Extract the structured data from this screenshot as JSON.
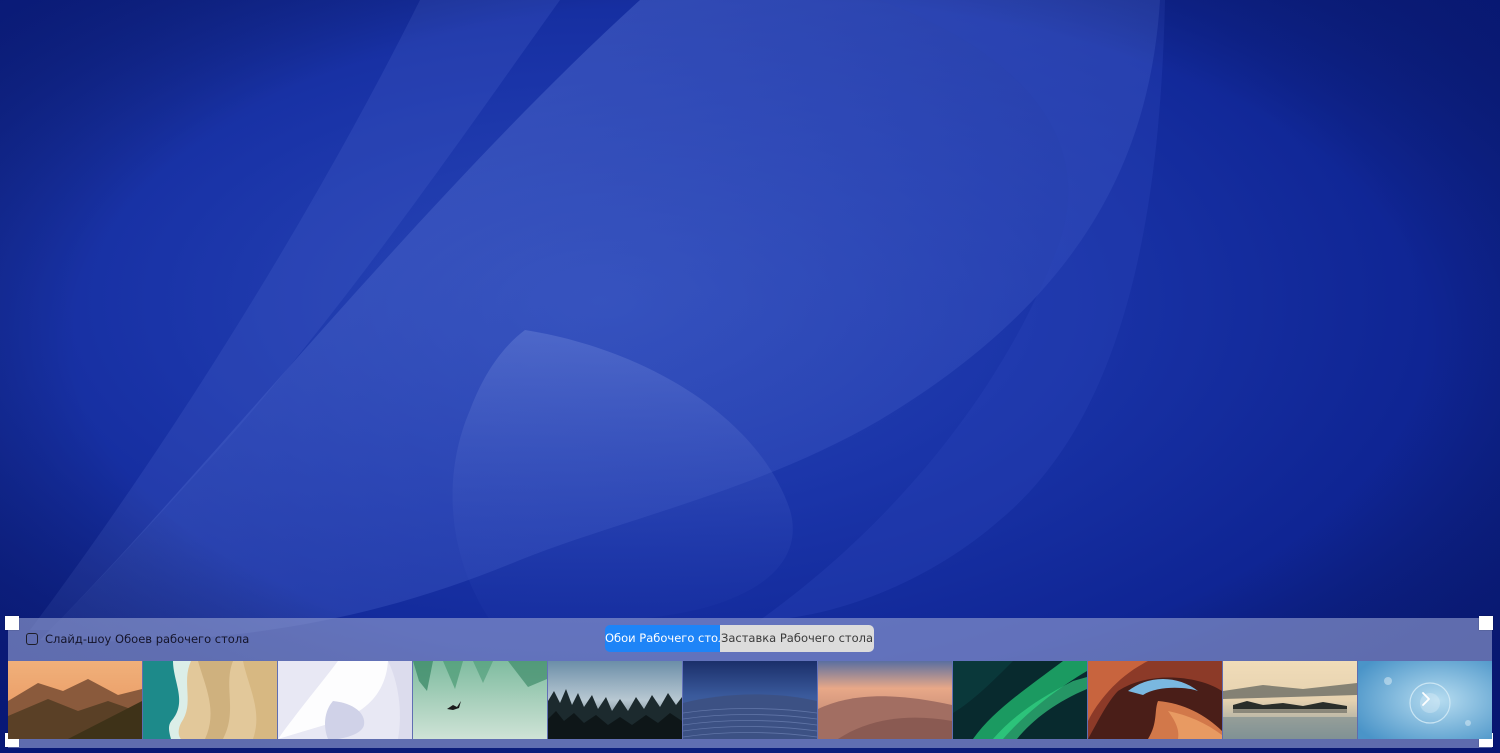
{
  "panel": {
    "slideshow_label": "Слайд-шоу Обоев рабочего стола",
    "slideshow_checked": false
  },
  "tabs": {
    "wallpaper_label": "Обои Рабочего стола",
    "screensaver_label": "Заставка Рабочего стола",
    "active": "wallpaper"
  },
  "thumbnails": [
    {
      "subject": "mountain-sunset"
    },
    {
      "subject": "aerial-coastline"
    },
    {
      "subject": "white-abstract"
    },
    {
      "subject": "green-valley-bird"
    },
    {
      "subject": "misty-forest"
    },
    {
      "subject": "blue-dunes-night"
    },
    {
      "subject": "desert-dune-sunset"
    },
    {
      "subject": "aurora"
    },
    {
      "subject": "canyon-arch"
    },
    {
      "subject": "lake-reflection"
    },
    {
      "subject": "blue-water-drop"
    }
  ],
  "icons": {
    "next": "chevron-right-icon"
  },
  "colors": {
    "accent": "#1e84f7",
    "desktop_blue": "#1a34a8"
  }
}
